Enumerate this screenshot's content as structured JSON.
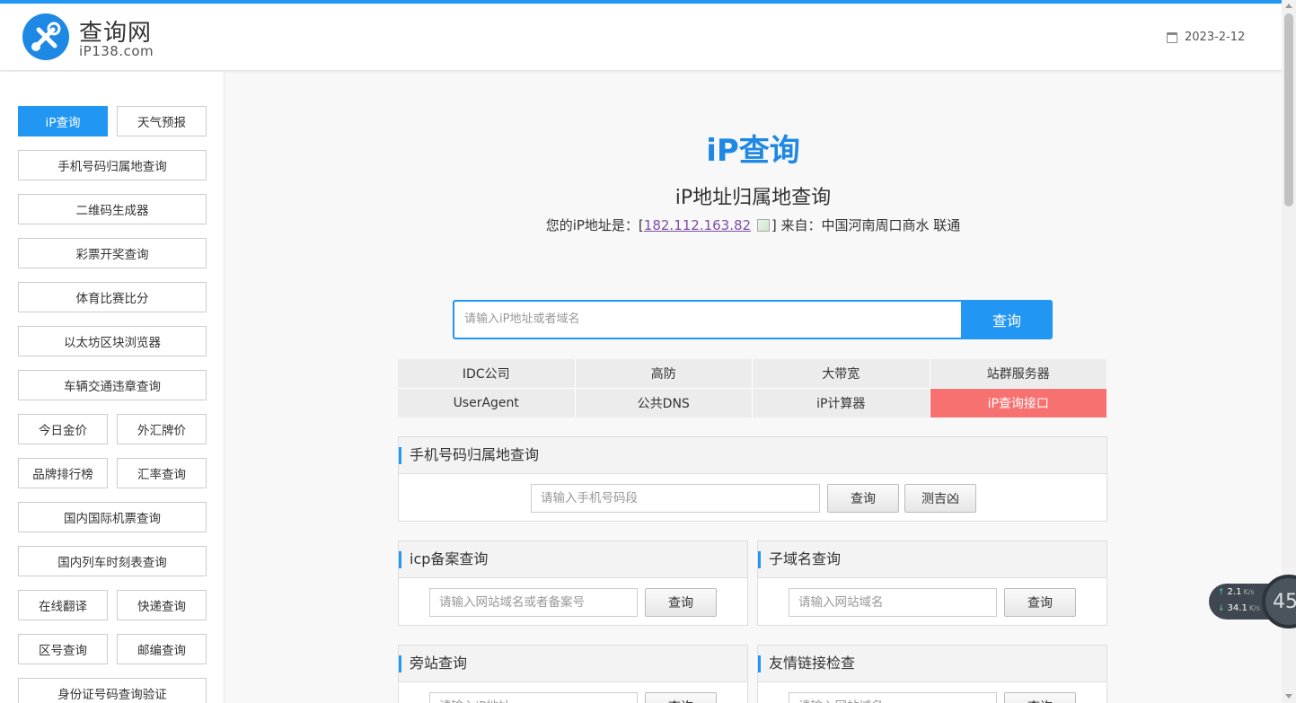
{
  "header": {
    "logo_title": "查询网",
    "logo_sub": "iP138.com",
    "date": "2023-2-12"
  },
  "sidebar": {
    "items": [
      {
        "label": "iP查询",
        "active": true
      },
      {
        "label": "天气预报"
      },
      {
        "label": "手机号码归属地查询"
      },
      {
        "label": "二维码生成器"
      },
      {
        "label": "彩票开奖查询"
      },
      {
        "label": "体育比赛比分"
      },
      {
        "label": "以太坊区块浏览器"
      },
      {
        "label": "车辆交通违章查询"
      },
      {
        "label": "今日金价"
      },
      {
        "label": "外汇牌价"
      },
      {
        "label": "品牌排行榜"
      },
      {
        "label": "汇率查询"
      },
      {
        "label": "国内国际机票查询"
      },
      {
        "label": "国内列车时刻表查询"
      },
      {
        "label": "在线翻译"
      },
      {
        "label": "快递查询"
      },
      {
        "label": "区号查询"
      },
      {
        "label": "邮编查询"
      },
      {
        "label": "身份证号码查询验证"
      }
    ]
  },
  "main": {
    "title": "iP查询",
    "subtitle": "iP地址归属地查询",
    "ip_prefix": "您的iP地址是：[",
    "ip_address": "182.112.163.82",
    "ip_suffix": "] 来自：中国河南周口商水 联通",
    "search": {
      "placeholder": "请输入iP地址或者域名",
      "button": "查询"
    },
    "quick_links": [
      {
        "label": "IDC公司"
      },
      {
        "label": "高防"
      },
      {
        "label": "大带宽"
      },
      {
        "label": "站群服务器"
      },
      {
        "label": "UserAgent"
      },
      {
        "label": "公共DNS"
      },
      {
        "label": "iP计算器"
      },
      {
        "label": "iP查询接口",
        "highlight": true
      }
    ],
    "panels": {
      "phone": {
        "title": "手机号码归属地查询",
        "placeholder": "请输入手机号码段",
        "button": "查询",
        "button2": "测吉凶"
      },
      "icp": {
        "title": "icp备案查询",
        "placeholder": "请输入网站域名或者备案号",
        "button": "查询"
      },
      "subdomain": {
        "title": "子域名查询",
        "placeholder": "请输入网站域名",
        "button": "查询"
      },
      "sidesite": {
        "title": "旁站查询",
        "placeholder": "请输入iP地址",
        "button": "查询"
      },
      "friendlink": {
        "title": "友情链接检查",
        "placeholder": "请输入网站域名",
        "button": "查询"
      }
    }
  },
  "net_widget": {
    "upload": "2.1",
    "download": "34.1",
    "unit": "K/s",
    "percent": "45"
  },
  "colors": {
    "accent": "#2196f3",
    "highlight": "#f87171"
  }
}
